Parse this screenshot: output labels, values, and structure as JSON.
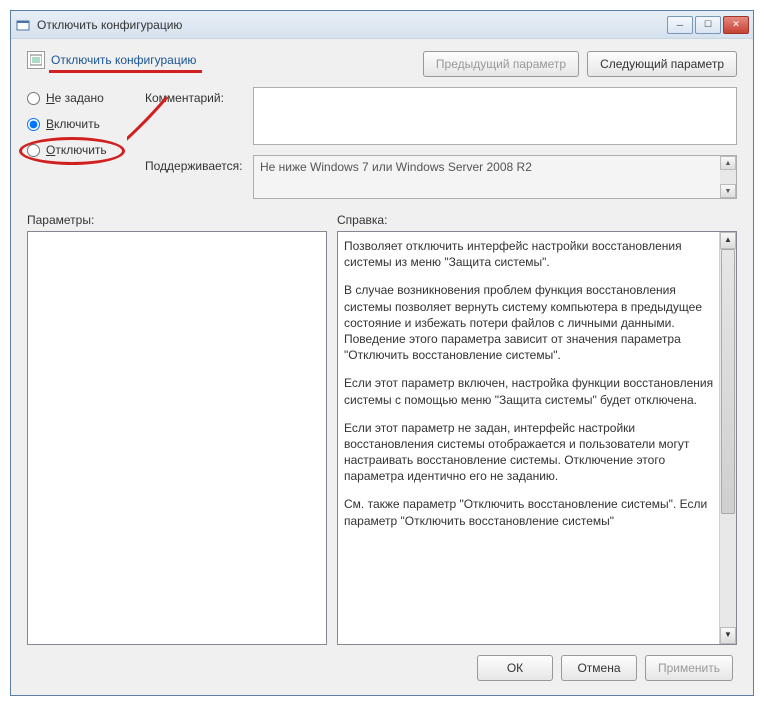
{
  "window": {
    "title": "Отключить конфигурацию"
  },
  "header": {
    "policy_name": "Отключить конфигурацию",
    "prev_btn": "Предыдущий параметр",
    "next_btn": "Следующий параметр"
  },
  "radios": {
    "not_configured": "Не задано",
    "enabled": "Включить",
    "disabled": "Отключить"
  },
  "fields": {
    "comment_label": "Комментарий:",
    "comment_value": "",
    "supported_label": "Поддерживается:",
    "supported_value": "Не ниже Windows 7 или Windows Server 2008 R2"
  },
  "lower": {
    "params_label": "Параметры:",
    "help_label": "Справка:",
    "help_paragraphs": [
      "Позволяет отключить интерфейс настройки восстановления системы из меню \"Защита системы\".",
      "В случае возникновения проблем функция восстановления системы позволяет вернуть систему компьютера в предыдущее состояние и избежать потери файлов с личными данными. Поведение этого параметра зависит от значения параметра \"Отключить восстановление системы\".",
      "Если этот параметр включен, настройка функции восстановления системы с помощью меню \"Защита системы\" будет отключена.",
      "Если этот параметр не задан, интерфейс настройки восстановления системы отображается и пользователи могут настраивать восстановление системы. Отключение этого параметра идентично его не заданию.",
      "См. также параметр \"Отключить восстановление системы\". Если параметр \"Отключить восстановление системы\""
    ]
  },
  "footer": {
    "ok": "ОК",
    "cancel": "Отмена",
    "apply": "Применить"
  }
}
